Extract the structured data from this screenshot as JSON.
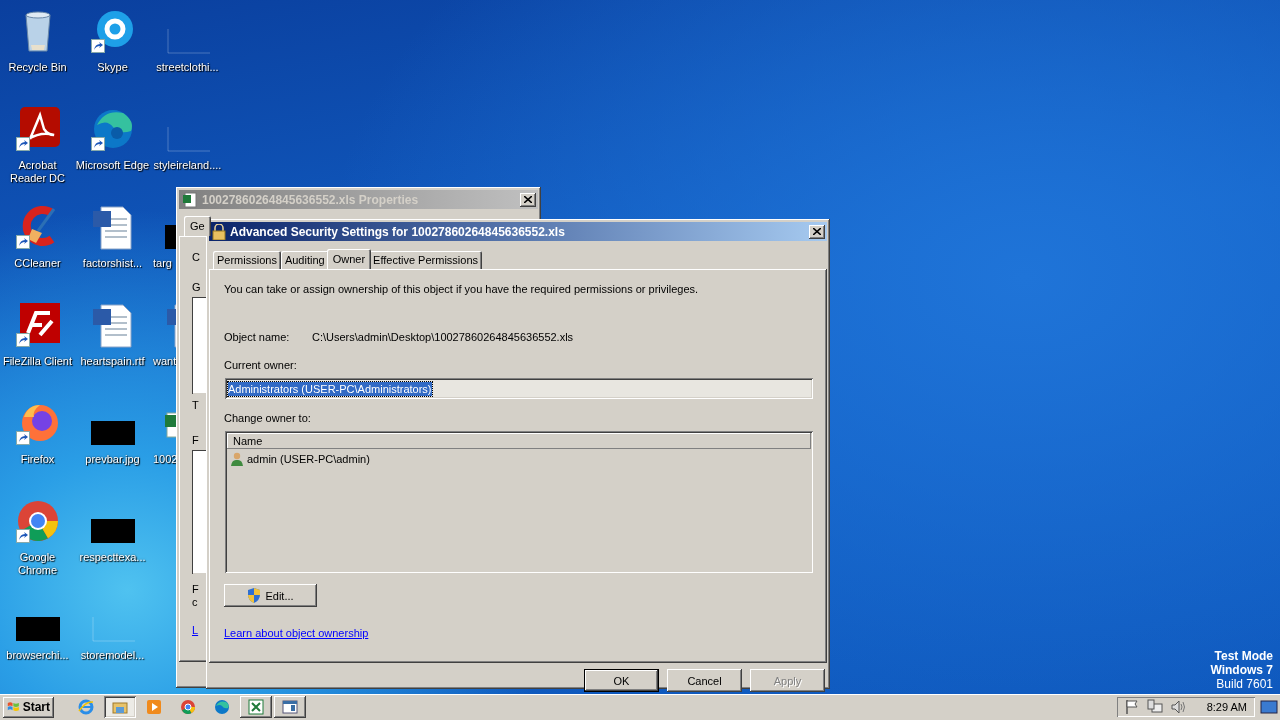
{
  "desktop_icons": [
    {
      "label": "Recycle Bin",
      "kind": "recycle-bin",
      "shortcut": false,
      "cut": false
    },
    {
      "label": "Acrobat Reader DC",
      "kind": "acrobat",
      "shortcut": true,
      "cut": false
    },
    {
      "label": "CCleaner",
      "kind": "ccleaner",
      "shortcut": true,
      "cut": false
    },
    {
      "label": "FileZilla Client",
      "kind": "filezilla",
      "shortcut": true,
      "cut": false
    },
    {
      "label": "Firefox",
      "kind": "firefox",
      "shortcut": true,
      "cut": false
    },
    {
      "label": "Google Chrome",
      "kind": "chrome",
      "shortcut": true,
      "cut": false
    },
    {
      "label": "browserchi...",
      "kind": "thumbnail",
      "shortcut": false,
      "cut": false
    },
    {
      "label": "Skype",
      "kind": "skype",
      "shortcut": true,
      "cut": false
    },
    {
      "label": "Microsoft Edge",
      "kind": "edge",
      "shortcut": true,
      "cut": false
    },
    {
      "label": "factorshist...",
      "kind": "word",
      "shortcut": false,
      "cut": false
    },
    {
      "label": "heartspain.rtf",
      "kind": "word",
      "shortcut": false,
      "cut": false
    },
    {
      "label": "prevbar.jpg",
      "kind": "thumbnail",
      "shortcut": false,
      "cut": false
    },
    {
      "label": "respecttexa...",
      "kind": "thumbnail",
      "shortcut": false,
      "cut": false
    },
    {
      "label": "storemodel...",
      "kind": "blank",
      "shortcut": false,
      "cut": false
    },
    {
      "label": "streetclothi...",
      "kind": "blank",
      "shortcut": false,
      "cut": false
    },
    {
      "label": "styleireland....",
      "kind": "blank",
      "shortcut": false,
      "cut": false
    },
    {
      "label": "targ",
      "kind": "thumbnail",
      "shortcut": false,
      "cut": true
    },
    {
      "label": "want",
      "kind": "word",
      "shortcut": false,
      "cut": true
    },
    {
      "label": "1002",
      "kind": "excel",
      "shortcut": false,
      "cut": true
    }
  ],
  "properties_window": {
    "title": "10027860264845636552.xls Properties",
    "active": false,
    "tabs": [
      {
        "label": "Ge",
        "selected": true
      }
    ],
    "labels": [
      "C",
      "G",
      "T",
      "F",
      "F",
      "c"
    ],
    "link": "L"
  },
  "security_dialog": {
    "title": "Advanced Security Settings for 10027860264845636552.xls",
    "active": true,
    "tabs": [
      {
        "label": "Permissions",
        "selected": false
      },
      {
        "label": "Auditing",
        "selected": false
      },
      {
        "label": "Owner",
        "selected": true
      },
      {
        "label": "Effective Permissions",
        "selected": false
      }
    ],
    "intro": "You can take or assign ownership of this object if you have the required permissions or privileges.",
    "object_name_label": "Object name:",
    "object_name": "C:\\Users\\admin\\Desktop\\10027860264845636552.xls",
    "current_owner_label": "Current owner:",
    "current_owner": {
      "value": "Administrators (USER-PC\\Administrators)",
      "text_selected": true
    },
    "change_owner_label": "Change owner to:",
    "owner_list": {
      "columns": [
        "Name"
      ],
      "rows": [
        {
          "name": "admin (USER-PC\\admin)",
          "selected": false
        }
      ]
    },
    "edit_button": "Edit...",
    "link": "Learn about object ownership",
    "buttons": [
      {
        "label": "OK",
        "default": true,
        "disabled": false
      },
      {
        "label": "Cancel",
        "default": false,
        "disabled": false
      },
      {
        "label": "Apply",
        "default": false,
        "disabled": true
      }
    ]
  },
  "watermark": [
    "Test Mode",
    "Windows 7",
    "Build 7601"
  ],
  "taskbar": {
    "start": "Start",
    "items": [
      {
        "kind": "ie",
        "window": false,
        "selected": false
      },
      {
        "kind": "explorer",
        "window": true,
        "selected": true
      },
      {
        "kind": "media",
        "window": false,
        "selected": false
      },
      {
        "kind": "chrome",
        "window": false,
        "selected": false
      },
      {
        "kind": "edge",
        "window": false,
        "selected": false
      },
      {
        "kind": "excel",
        "window": true,
        "selected": false
      },
      {
        "kind": "app",
        "window": true,
        "selected": false
      }
    ],
    "clock": "8:29 AM"
  }
}
